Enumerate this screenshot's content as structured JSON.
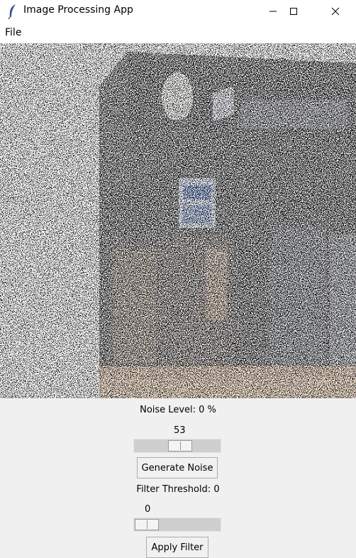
{
  "window": {
    "title": "Image Processing App"
  },
  "menubar": {
    "items": [
      {
        "label": "File"
      }
    ]
  },
  "controls": {
    "noise_label": "Noise Level: 0 %",
    "noise_slider_value": "53",
    "generate_button": "Generate Noise",
    "filter_label": "Filter Threshold: 0",
    "filter_slider_value": "0",
    "apply_button": "Apply Filter"
  }
}
